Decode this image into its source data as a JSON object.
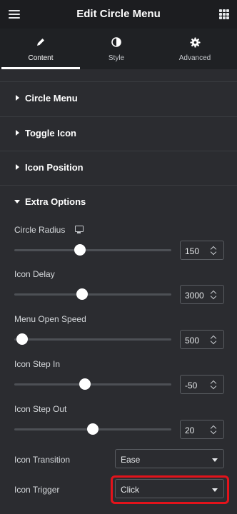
{
  "header": {
    "title": "Edit Circle Menu",
    "menu_icon": "hamburger-icon",
    "apps_icon": "grid-icon"
  },
  "tabs": [
    {
      "label": "Content",
      "icon": "pencil-icon",
      "active": true
    },
    {
      "label": "Style",
      "icon": "half-circle-icon",
      "active": false
    },
    {
      "label": "Advanced",
      "icon": "gear-icon",
      "active": false
    }
  ],
  "sections": [
    {
      "label": "Circle Menu",
      "expanded": false
    },
    {
      "label": "Toggle Icon",
      "expanded": false
    },
    {
      "label": "Icon Position",
      "expanded": false
    },
    {
      "label": "Extra Options",
      "expanded": true
    }
  ],
  "controls": {
    "circle_radius": {
      "label": "Circle Radius",
      "value": "150",
      "slider_fraction": 0.42,
      "device_icon": "desktop-icon"
    },
    "icon_delay": {
      "label": "Icon Delay",
      "value": "3000",
      "slider_fraction": 0.43
    },
    "menu_open_speed": {
      "label": "Menu Open Speed",
      "value": "500",
      "slider_fraction": 0.05
    },
    "icon_step_in": {
      "label": "Icon Step In",
      "value": "-50",
      "slider_fraction": 0.45
    },
    "icon_step_out": {
      "label": "Icon Step Out",
      "value": "20",
      "slider_fraction": 0.5
    },
    "icon_transition": {
      "label": "Icon Transition",
      "value": "Ease"
    },
    "icon_trigger": {
      "label": "Icon Trigger",
      "value": "Click"
    }
  },
  "colors": {
    "background": "#2b2c30",
    "topbar": "#1c1d20",
    "highlight": "#e3131b",
    "text": "#e6e8ea"
  }
}
